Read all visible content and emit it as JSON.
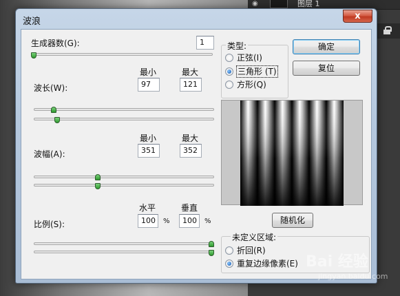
{
  "background": {
    "layer_name": "图层 1"
  },
  "dialog": {
    "title": "波浪",
    "close_glyph": "x",
    "generators": {
      "label": "生成器数(G):",
      "value": "1",
      "slider_fraction": 0.0
    },
    "wavelength": {
      "label": "波长(W):",
      "min_header": "最小",
      "max_header": "最大",
      "min": "97",
      "max": "121",
      "min_fraction": 0.1,
      "max_fraction": 0.12
    },
    "amplitude": {
      "label": "波幅(A):",
      "min_header": "最小",
      "max_header": "最大",
      "min": "351",
      "max": "352",
      "min_fraction": 0.35,
      "max_fraction": 0.352
    },
    "scale": {
      "label": "比例(S):",
      "horizontal_header": "水平",
      "vertical_header": "垂直",
      "horizontal": "100",
      "vertical": "100",
      "unit": "%",
      "horizontal_fraction": 1.0,
      "vertical_fraction": 1.0
    },
    "type_group": {
      "title": "类型:",
      "options": [
        {
          "label": "正弦(I)",
          "checked": false
        },
        {
          "label": "三角形 (T)",
          "checked": true
        },
        {
          "label": "方形(Q)",
          "checked": false
        }
      ]
    },
    "buttons": {
      "ok": "确定",
      "reset": "复位",
      "randomize": "随机化"
    },
    "undefined_area": {
      "title": "未定义区域:",
      "options": [
        {
          "label": "折回(R)",
          "checked": false
        },
        {
          "label": "重复边缘像素(E)",
          "checked": true
        }
      ]
    },
    "preview": {
      "wave_count": 6,
      "background_color": "#c8c8c8",
      "wave_dark": "#000000",
      "wave_light": "#ffffff"
    }
  },
  "watermark": {
    "brand": "Bai  经验",
    "url": "jingyan.baidu.com"
  }
}
